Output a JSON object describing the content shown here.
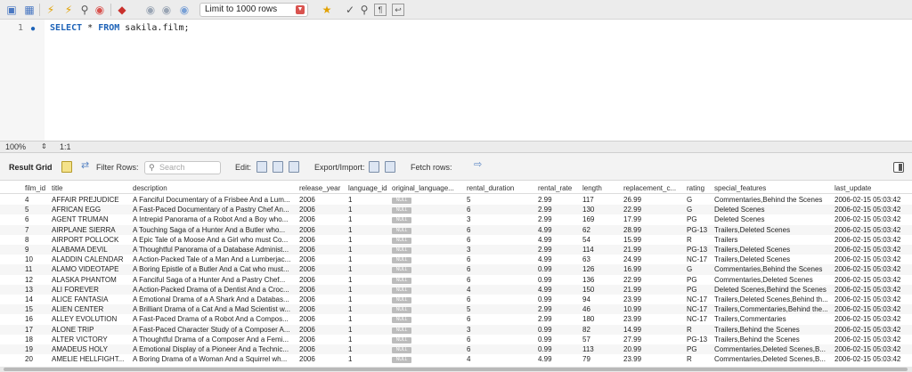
{
  "toolbar": {
    "limit_label": "Limit to 1000 rows"
  },
  "editor": {
    "line_number": "1",
    "sql": {
      "select_kw": "SELECT",
      "star": " * ",
      "from_kw": "FROM",
      "table": " sakila.film;"
    }
  },
  "zoom": {
    "level": "100%",
    "position": "1:1"
  },
  "result_toolbar": {
    "title": "Result Grid",
    "filter_label": "Filter Rows:",
    "search_placeholder": "Search",
    "edit_label": "Edit:",
    "export_label": "Export/Import:",
    "fetch_label": "Fetch rows:"
  },
  "grid": {
    "columns": [
      "film_id",
      "title",
      "description",
      "release_year",
      "language_id",
      "original_language...",
      "rental_duration",
      "rental_rate",
      "length",
      "replacement_c...",
      "rating",
      "special_features",
      "last_update"
    ],
    "null_label": "NULL",
    "rows": [
      [
        "4",
        "AFFAIR PREJUDICE",
        "A Fanciful Documentary of a Frisbee And a Lum...",
        "2006",
        "1",
        "NULL",
        "5",
        "2.99",
        "117",
        "26.99",
        "G",
        "Commentaries,Behind the Scenes",
        "2006-02-15 05:03:42"
      ],
      [
        "5",
        "AFRICAN EGG",
        "A Fast-Paced Documentary of a Pastry Chef An...",
        "2006",
        "1",
        "NULL",
        "6",
        "2.99",
        "130",
        "22.99",
        "G",
        "Deleted Scenes",
        "2006-02-15 05:03:42"
      ],
      [
        "6",
        "AGENT TRUMAN",
        "A Intrepid Panorama of a Robot And a Boy who...",
        "2006",
        "1",
        "NULL",
        "3",
        "2.99",
        "169",
        "17.99",
        "PG",
        "Deleted Scenes",
        "2006-02-15 05:03:42"
      ],
      [
        "7",
        "AIRPLANE SIERRA",
        "A Touching Saga of a Hunter And a Butler who...",
        "2006",
        "1",
        "NULL",
        "6",
        "4.99",
        "62",
        "28.99",
        "PG-13",
        "Trailers,Deleted Scenes",
        "2006-02-15 05:03:42"
      ],
      [
        "8",
        "AIRPORT POLLOCK",
        "A Epic Tale of a Moose And a Girl who must Co...",
        "2006",
        "1",
        "NULL",
        "6",
        "4.99",
        "54",
        "15.99",
        "R",
        "Trailers",
        "2006-02-15 05:03:42"
      ],
      [
        "9",
        "ALABAMA DEVIL",
        "A Thoughtful Panorama of a Database Administ...",
        "2006",
        "1",
        "NULL",
        "3",
        "2.99",
        "114",
        "21.99",
        "PG-13",
        "Trailers,Deleted Scenes",
        "2006-02-15 05:03:42"
      ],
      [
        "10",
        "ALADDIN CALENDAR",
        "A Action-Packed Tale of a Man And a Lumberjac...",
        "2006",
        "1",
        "NULL",
        "6",
        "4.99",
        "63",
        "24.99",
        "NC-17",
        "Trailers,Deleted Scenes",
        "2006-02-15 05:03:42"
      ],
      [
        "11",
        "ALAMO VIDEOTAPE",
        "A Boring Epistle of a Butler And a Cat who must...",
        "2006",
        "1",
        "NULL",
        "6",
        "0.99",
        "126",
        "16.99",
        "G",
        "Commentaries,Behind the Scenes",
        "2006-02-15 05:03:42"
      ],
      [
        "12",
        "ALASKA PHANTOM",
        "A Fanciful Saga of a Hunter And a Pastry Chef...",
        "2006",
        "1",
        "NULL",
        "6",
        "0.99",
        "136",
        "22.99",
        "PG",
        "Commentaries,Deleted Scenes",
        "2006-02-15 05:03:42"
      ],
      [
        "13",
        "ALI FOREVER",
        "A Action-Packed Drama of a Dentist And a Croc...",
        "2006",
        "1",
        "NULL",
        "4",
        "4.99",
        "150",
        "21.99",
        "PG",
        "Deleted Scenes,Behind the Scenes",
        "2006-02-15 05:03:42"
      ],
      [
        "14",
        "ALICE FANTASIA",
        "A Emotional Drama of a A Shark And a Databas...",
        "2006",
        "1",
        "NULL",
        "6",
        "0.99",
        "94",
        "23.99",
        "NC-17",
        "Trailers,Deleted Scenes,Behind th...",
        "2006-02-15 05:03:42"
      ],
      [
        "15",
        "ALIEN CENTER",
        "A Brilliant Drama of a Cat And a Mad Scientist w...",
        "2006",
        "1",
        "NULL",
        "5",
        "2.99",
        "46",
        "10.99",
        "NC-17",
        "Trailers,Commentaries,Behind the...",
        "2006-02-15 05:03:42"
      ],
      [
        "16",
        "ALLEY EVOLUTION",
        "A Fast-Paced Drama of a Robot And a Compos...",
        "2006",
        "1",
        "NULL",
        "6",
        "2.99",
        "180",
        "23.99",
        "NC-17",
        "Trailers,Commentaries",
        "2006-02-15 05:03:42"
      ],
      [
        "17",
        "ALONE TRIP",
        "A Fast-Paced Character Study of a Composer A...",
        "2006",
        "1",
        "NULL",
        "3",
        "0.99",
        "82",
        "14.99",
        "R",
        "Trailers,Behind the Scenes",
        "2006-02-15 05:03:42"
      ],
      [
        "18",
        "ALTER VICTORY",
        "A Thoughtful Drama of a Composer And a Femi...",
        "2006",
        "1",
        "NULL",
        "6",
        "0.99",
        "57",
        "27.99",
        "PG-13",
        "Trailers,Behind the Scenes",
        "2006-02-15 05:03:42"
      ],
      [
        "19",
        "AMADEUS HOLY",
        "A Emotional Display of a Pioneer And a Technic...",
        "2006",
        "1",
        "NULL",
        "6",
        "0.99",
        "113",
        "20.99",
        "PG",
        "Commentaries,Deleted Scenes,B...",
        "2006-02-15 05:03:42"
      ],
      [
        "20",
        "AMELIE HELLFIGHT...",
        "A Boring Drama of a Woman And a Squirrel wh...",
        "2006",
        "1",
        "NULL",
        "4",
        "4.99",
        "79",
        "23.99",
        "R",
        "Commentaries,Deleted Scenes,B...",
        "2006-02-15 05:03:42"
      ]
    ]
  }
}
